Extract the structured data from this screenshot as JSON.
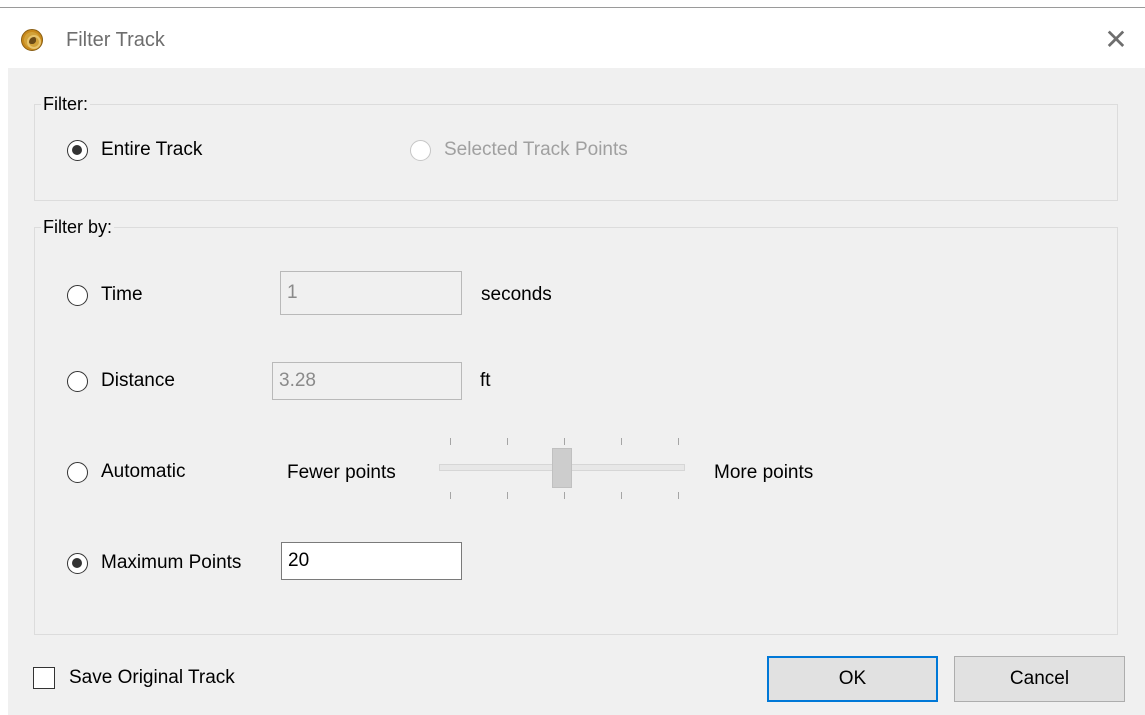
{
  "window": {
    "title": "Filter Track",
    "close_glyph": "✕"
  },
  "filter_group": {
    "legend": "Filter:",
    "options": [
      {
        "label": "Entire Track",
        "checked": true,
        "enabled": true
      },
      {
        "label": "Selected Track Points",
        "checked": false,
        "enabled": false
      }
    ]
  },
  "filter_by_group": {
    "legend": "Filter by:",
    "time": {
      "label": "Time",
      "checked": false,
      "value": "1",
      "unit": "seconds"
    },
    "distance": {
      "label": "Distance",
      "checked": false,
      "value": "3.28",
      "unit": "ft"
    },
    "automatic": {
      "label": "Automatic",
      "checked": false,
      "min_label": "Fewer points",
      "max_label": "More points",
      "slider_value": 0.5,
      "tick_count": 5
    },
    "max_points": {
      "label": "Maximum Points",
      "checked": true,
      "value": "20"
    }
  },
  "footer": {
    "save_original_label": "Save Original Track",
    "save_original_checked": false,
    "ok_label": "OK",
    "cancel_label": "Cancel"
  },
  "colors": {
    "accent_focus": "#0078d7",
    "dialog_bg": "#f0f0f0"
  }
}
